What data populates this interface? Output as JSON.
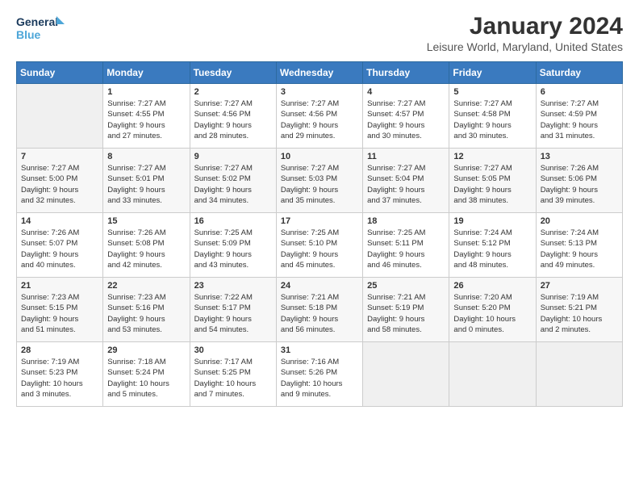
{
  "app": {
    "logo_line1": "General",
    "logo_line2": "Blue"
  },
  "header": {
    "title": "January 2024",
    "subtitle": "Leisure World, Maryland, United States"
  },
  "days_of_week": [
    "Sunday",
    "Monday",
    "Tuesday",
    "Wednesday",
    "Thursday",
    "Friday",
    "Saturday"
  ],
  "weeks": [
    [
      {
        "day": "",
        "info": ""
      },
      {
        "day": "1",
        "info": "Sunrise: 7:27 AM\nSunset: 4:55 PM\nDaylight: 9 hours\nand 27 minutes."
      },
      {
        "day": "2",
        "info": "Sunrise: 7:27 AM\nSunset: 4:56 PM\nDaylight: 9 hours\nand 28 minutes."
      },
      {
        "day": "3",
        "info": "Sunrise: 7:27 AM\nSunset: 4:56 PM\nDaylight: 9 hours\nand 29 minutes."
      },
      {
        "day": "4",
        "info": "Sunrise: 7:27 AM\nSunset: 4:57 PM\nDaylight: 9 hours\nand 30 minutes."
      },
      {
        "day": "5",
        "info": "Sunrise: 7:27 AM\nSunset: 4:58 PM\nDaylight: 9 hours\nand 30 minutes."
      },
      {
        "day": "6",
        "info": "Sunrise: 7:27 AM\nSunset: 4:59 PM\nDaylight: 9 hours\nand 31 minutes."
      }
    ],
    [
      {
        "day": "7",
        "info": "Sunrise: 7:27 AM\nSunset: 5:00 PM\nDaylight: 9 hours\nand 32 minutes."
      },
      {
        "day": "8",
        "info": "Sunrise: 7:27 AM\nSunset: 5:01 PM\nDaylight: 9 hours\nand 33 minutes."
      },
      {
        "day": "9",
        "info": "Sunrise: 7:27 AM\nSunset: 5:02 PM\nDaylight: 9 hours\nand 34 minutes."
      },
      {
        "day": "10",
        "info": "Sunrise: 7:27 AM\nSunset: 5:03 PM\nDaylight: 9 hours\nand 35 minutes."
      },
      {
        "day": "11",
        "info": "Sunrise: 7:27 AM\nSunset: 5:04 PM\nDaylight: 9 hours\nand 37 minutes."
      },
      {
        "day": "12",
        "info": "Sunrise: 7:27 AM\nSunset: 5:05 PM\nDaylight: 9 hours\nand 38 minutes."
      },
      {
        "day": "13",
        "info": "Sunrise: 7:26 AM\nSunset: 5:06 PM\nDaylight: 9 hours\nand 39 minutes."
      }
    ],
    [
      {
        "day": "14",
        "info": "Sunrise: 7:26 AM\nSunset: 5:07 PM\nDaylight: 9 hours\nand 40 minutes."
      },
      {
        "day": "15",
        "info": "Sunrise: 7:26 AM\nSunset: 5:08 PM\nDaylight: 9 hours\nand 42 minutes."
      },
      {
        "day": "16",
        "info": "Sunrise: 7:25 AM\nSunset: 5:09 PM\nDaylight: 9 hours\nand 43 minutes."
      },
      {
        "day": "17",
        "info": "Sunrise: 7:25 AM\nSunset: 5:10 PM\nDaylight: 9 hours\nand 45 minutes."
      },
      {
        "day": "18",
        "info": "Sunrise: 7:25 AM\nSunset: 5:11 PM\nDaylight: 9 hours\nand 46 minutes."
      },
      {
        "day": "19",
        "info": "Sunrise: 7:24 AM\nSunset: 5:12 PM\nDaylight: 9 hours\nand 48 minutes."
      },
      {
        "day": "20",
        "info": "Sunrise: 7:24 AM\nSunset: 5:13 PM\nDaylight: 9 hours\nand 49 minutes."
      }
    ],
    [
      {
        "day": "21",
        "info": "Sunrise: 7:23 AM\nSunset: 5:15 PM\nDaylight: 9 hours\nand 51 minutes."
      },
      {
        "day": "22",
        "info": "Sunrise: 7:23 AM\nSunset: 5:16 PM\nDaylight: 9 hours\nand 53 minutes."
      },
      {
        "day": "23",
        "info": "Sunrise: 7:22 AM\nSunset: 5:17 PM\nDaylight: 9 hours\nand 54 minutes."
      },
      {
        "day": "24",
        "info": "Sunrise: 7:21 AM\nSunset: 5:18 PM\nDaylight: 9 hours\nand 56 minutes."
      },
      {
        "day": "25",
        "info": "Sunrise: 7:21 AM\nSunset: 5:19 PM\nDaylight: 9 hours\nand 58 minutes."
      },
      {
        "day": "26",
        "info": "Sunrise: 7:20 AM\nSunset: 5:20 PM\nDaylight: 10 hours\nand 0 minutes."
      },
      {
        "day": "27",
        "info": "Sunrise: 7:19 AM\nSunset: 5:21 PM\nDaylight: 10 hours\nand 2 minutes."
      }
    ],
    [
      {
        "day": "28",
        "info": "Sunrise: 7:19 AM\nSunset: 5:23 PM\nDaylight: 10 hours\nand 3 minutes."
      },
      {
        "day": "29",
        "info": "Sunrise: 7:18 AM\nSunset: 5:24 PM\nDaylight: 10 hours\nand 5 minutes."
      },
      {
        "day": "30",
        "info": "Sunrise: 7:17 AM\nSunset: 5:25 PM\nDaylight: 10 hours\nand 7 minutes."
      },
      {
        "day": "31",
        "info": "Sunrise: 7:16 AM\nSunset: 5:26 PM\nDaylight: 10 hours\nand 9 minutes."
      },
      {
        "day": "",
        "info": ""
      },
      {
        "day": "",
        "info": ""
      },
      {
        "day": "",
        "info": ""
      }
    ]
  ]
}
